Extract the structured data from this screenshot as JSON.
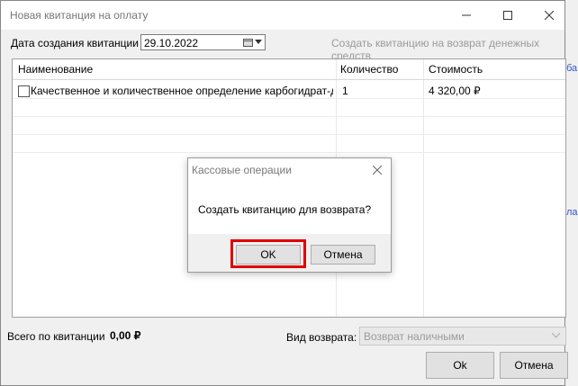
{
  "window": {
    "title": "Новая квитанция на оплату",
    "minimize_icon": "minimize-icon",
    "maximize_icon": "maximize-icon",
    "close_icon": "close-icon"
  },
  "form": {
    "date_label": "Дата создания квитанции",
    "date_value": "29.10.2022",
    "refund_link": "Создать квитанцию на возврат денежных средств"
  },
  "table": {
    "columns": [
      "Наименование",
      "Количество",
      "Стоимость"
    ],
    "rows": [
      {
        "checked": false,
        "name": "Качественное и количественное определение карбогидрат-дефи…",
        "quantity": "1",
        "cost": "4 320,00 ₽"
      }
    ]
  },
  "footer": {
    "total_label": "Всего по квитанции",
    "total_value": "0,00 ₽",
    "refund_type_label": "Вид возврата:",
    "refund_type_value": "Возврат наличными",
    "ok_label": "Ok",
    "cancel_label": "Отмена"
  },
  "modal": {
    "title": "Кассовые операции",
    "message": "Создать квитанцию для возврата?",
    "ok_label": "OK",
    "cancel_label": "Отмена"
  },
  "background": {
    "link_fragment_1": "ба",
    "link_fragment_2": "ла"
  },
  "colors": {
    "highlight": "#e00000",
    "link_gray": "#9a9a9a"
  }
}
